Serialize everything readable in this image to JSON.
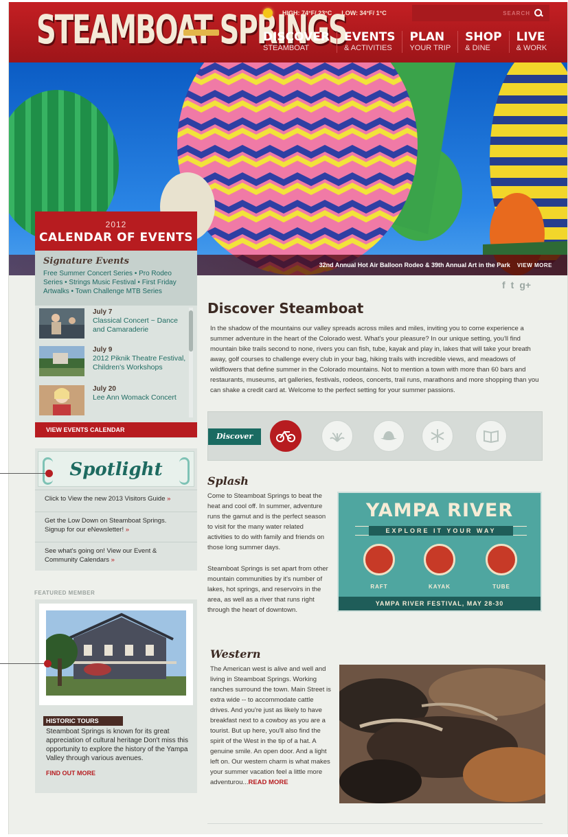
{
  "header": {
    "logo_text": "STEAMBOAT SPRINGS",
    "weather": {
      "high": "HIGH: 74°F/ 23°C",
      "low": "LOW: 34°F/ 1°C"
    },
    "search_placeholder": "SEARCH",
    "nav": [
      {
        "main": "DISCOVER",
        "sub": "STEAMBOAT"
      },
      {
        "main": "EVENTS",
        "sub": "& ACTIVITIES"
      },
      {
        "main": "PLAN",
        "sub": "YOUR TRIP"
      },
      {
        "main": "SHOP",
        "sub": "& DINE"
      },
      {
        "main": "LIVE",
        "sub": "& WORK"
      }
    ]
  },
  "hero": {
    "caption": "32nd Annual Hot Air Balloon Rodeo & 39th Annual Art in the Park",
    "view_more": "VIEW MORE"
  },
  "calendar": {
    "year": "2012",
    "title": "CALENDAR OF EVENTS",
    "signature_title": "Signature Events",
    "signature_text": "Free Summer Concert Series • Pro Rodeo Series • Strings Music Festival • First Friday Artwalks • Town Challenge MTB Series",
    "events": [
      {
        "date": "July 7",
        "title": "Classical Concert ~ Dance and Camaraderie"
      },
      {
        "date": "July 9",
        "title": "2012 Piknik Theatre Festival, Children's Workshops"
      },
      {
        "date": "July 20",
        "title": "Lee Ann Womack Concert"
      }
    ],
    "button": "VIEW EVENTS CALENDAR"
  },
  "spotlight": {
    "title": "Spotlight",
    "items": [
      "Click to View the new 2013 Visitors Guide",
      "Get the Low Down on Steamboat Springs. Signup for our eNewsletter!",
      "See what's going on! View our Event & Community Calendars"
    ]
  },
  "featured": {
    "label": "FEATURED MEMBER",
    "tag": "HISTORIC TOURS",
    "text": "Steamboat Springs is known for its great appreciation of cultural heritage Don't miss this opportunity to explore the history of the Yampa Valley through various avenues.",
    "link": "FIND OUT MORE"
  },
  "main": {
    "title": "Discover Steamboat",
    "intro": "In the shadow of the mountains our valley spreads across miles and miles, inviting you to come experience a summer adventure in the heart of the Colorado west. What's your pleasure? In our unique setting, you'll find mountain bike trails second to none, rivers you can fish, tube, kayak and play in, lakes that will take your breath away, golf courses to challenge every club in your bag, hiking trails with incredible views, and meadows of wildflowers that define summer in the Colorado mountains. Not to mention a town with more than 60 bars and restaurants, museums, art galleries, festivals, rodeos, concerts, trail runs, marathons and more shopping than you can shake a credit card at. Welcome to the perfect setting for your summer passions.",
    "discover_tag": "Discover",
    "categories": [
      "bike-icon",
      "fountain-icon",
      "hat-icon",
      "snowflake-icon",
      "book-icon"
    ]
  },
  "splash": {
    "title": "Splash",
    "para1": "Come to Steamboat Springs to beat the heat and cool off. In summer, adventure runs the gamut and is the perfect season to visit for the many water related activities to do with family and friends on those long summer days.",
    "para2": "Steamboat Springs is set apart from other mountain communities by it's number of lakes, hot springs, and reservoirs in the area, as well as a river that runs right through the heart of downtown."
  },
  "yampa": {
    "title": "YAMPA RIVER",
    "subtitle": "EXPLORE IT YOUR WAY",
    "labels": [
      "RAFT",
      "KAYAK",
      "TUBE"
    ],
    "footer": "YAMPA RIVER FESTIVAL, MAY 28-30"
  },
  "western": {
    "title": "Western",
    "text": "The American west is alive and well and living in Steamboat Springs. Working ranches surround the town. Main Street is extra wide -- to accommodate cattle drives. And you're just as likely to have breakfast next to a cowboy as you are a tourist. But up here, you'll also find the spirit of the West in the tip of a hat. A genuine smile. An open door. And a light left on. Our western charm is what makes your summer vacation feel a little more adventurou...",
    "read_more": "READ MORE"
  },
  "colors": {
    "brand_red": "#b71c20",
    "teal": "#1d6a60",
    "page_bg": "#eef0eb"
  }
}
